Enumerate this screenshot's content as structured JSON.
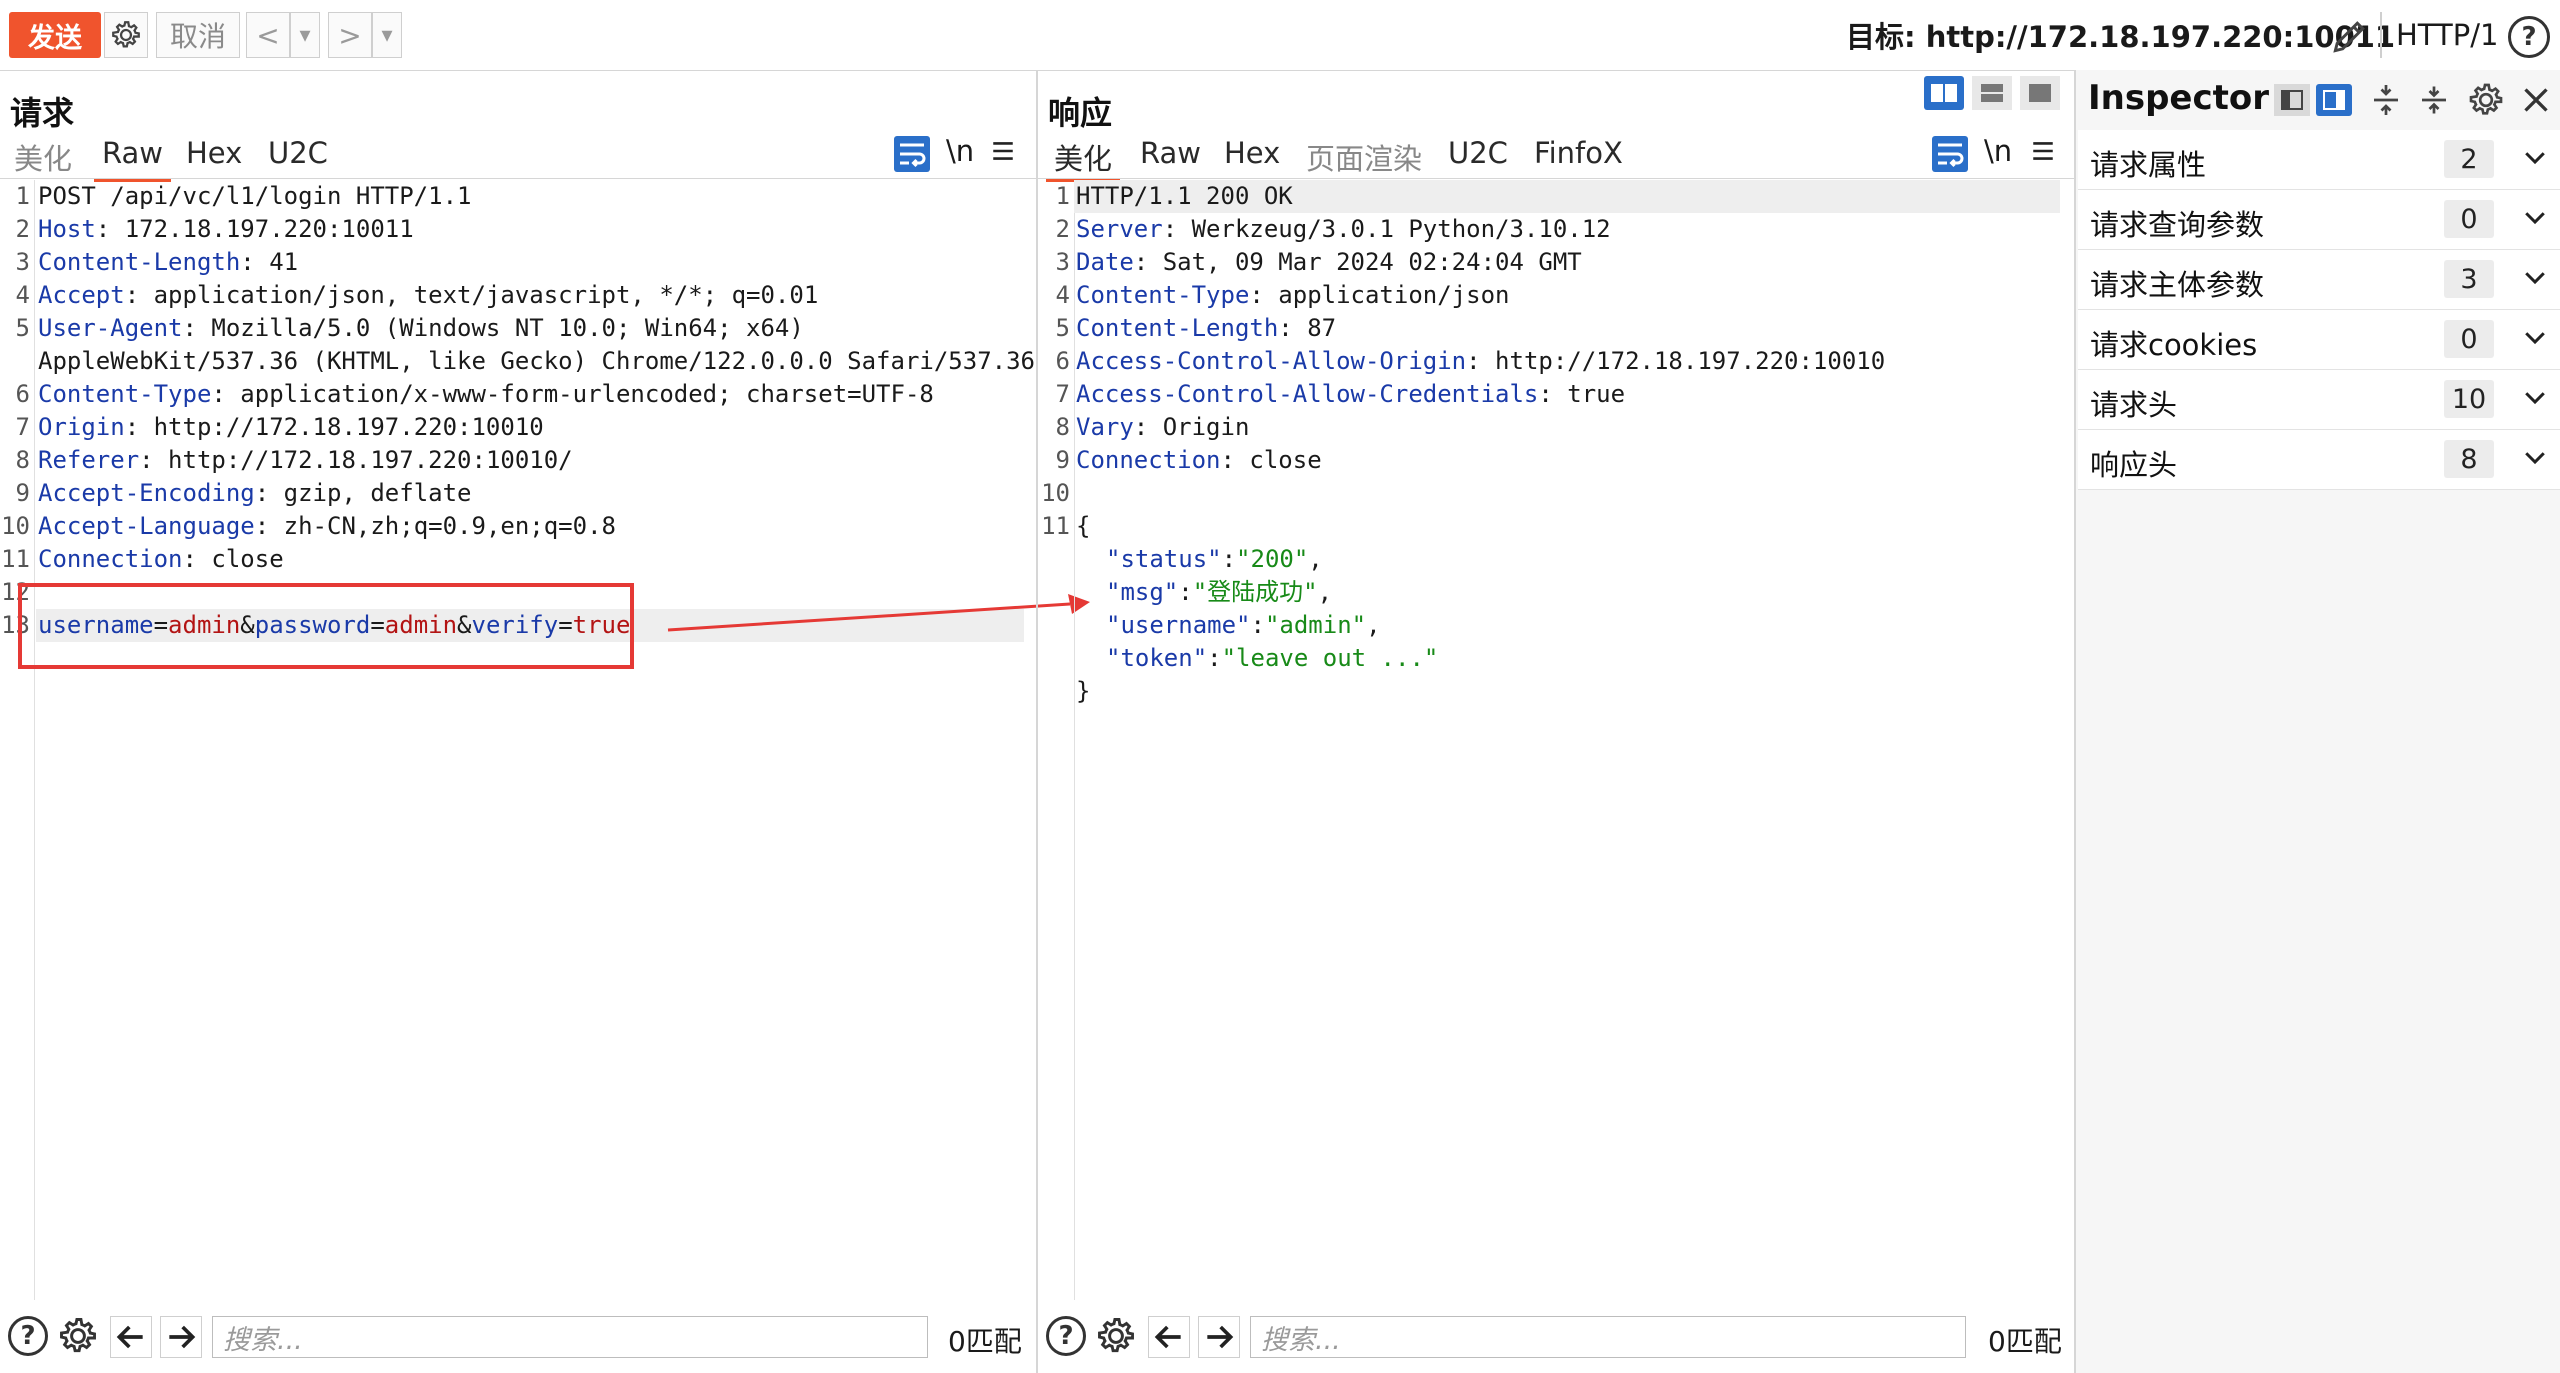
{
  "toolbar": {
    "send_label": "发送",
    "cancel_label": "取消",
    "prev_label": "<",
    "next_label": ">",
    "dropdown_glyph": "▾",
    "target_label": "目标: http://172.18.197.220:10011",
    "protocol_label": "HTTP/1",
    "help_glyph": "?"
  },
  "request": {
    "title": "请求",
    "tabs": [
      "美化",
      "Raw",
      "Hex",
      "U2C"
    ],
    "active_tab": "Raw",
    "newline_label": "\\n",
    "line_numbers": [
      "1",
      "2",
      "3",
      "4",
      "5",
      "",
      "6",
      "7",
      "8",
      "9",
      "10",
      "11",
      "12",
      "13"
    ],
    "headers": {
      "request_line": "POST /api/vc/l1/login HTTP/1.1",
      "host_key": "Host",
      "host_val": ": 172.18.197.220:10011",
      "cl_key": "Content-Length",
      "cl_val": ": 41",
      "accept_key": "Accept",
      "accept_val": ": application/json, text/javascript, */*; q=0.01",
      "ua_key": "User-Agent",
      "ua_val": ": Mozilla/5.0 (Windows NT 10.0; Win64; x64)",
      "ua_cont": "AppleWebKit/537.36 (KHTML, like Gecko) Chrome/122.0.0.0 Safari/537.36",
      "ct_key": "Content-Type",
      "ct_val": ": application/x-www-form-urlencoded; charset=UTF-8",
      "origin_key": "Origin",
      "origin_val": ": http://172.18.197.220:10010",
      "referer_key": "Referer",
      "referer_val": ": http://172.18.197.220:10010/",
      "ae_key": "Accept-Encoding",
      "ae_val": ": gzip, deflate",
      "al_key": "Accept-Language",
      "al_val": ": zh-CN,zh;q=0.9,en;q=0.8",
      "conn_key": "Connection",
      "conn_val": ": close"
    },
    "body": {
      "p1": "username",
      "eq1": "=",
      "v1": "admin",
      "amp1": "&",
      "p2": "password",
      "eq2": "=",
      "v2": "admin",
      "amp2": "&",
      "p3": "verify",
      "eq3": "=",
      "v3": "true"
    },
    "search_placeholder": "搜索...",
    "match_count": "0匹配"
  },
  "response": {
    "title": "响应",
    "tabs": [
      "美化",
      "Raw",
      "Hex",
      "页面渲染",
      "U2C",
      "FinfoX"
    ],
    "active_tab": "美化",
    "newline_label": "\\n",
    "line_numbers": [
      "1",
      "2",
      "3",
      "4",
      "5",
      "6",
      "7",
      "8",
      "9",
      "10",
      "11"
    ],
    "headers": {
      "status_line": "HTTP/1.1 200 OK",
      "server_key": "Server",
      "server_val": ": Werkzeug/3.0.1 Python/3.10.12",
      "date_key": "Date",
      "date_val": ": Sat, 09 Mar 2024 02:24:04 GMT",
      "ct_key": "Content-Type",
      "ct_val": ": application/json",
      "cl_key": "Content-Length",
      "cl_val": ": 87",
      "acao_key": "Access-Control-Allow-Origin",
      "acao_val": ": http://172.18.197.220:10010",
      "acac_key": "Access-Control-Allow-Credentials",
      "acac_val": ": true",
      "vary_key": "Vary",
      "vary_val": ": Origin",
      "conn_key": "Connection",
      "conn_val": ": close"
    },
    "json": {
      "open": "{",
      "status_key": "\"status\"",
      "status_val": "\"200\"",
      "msg_key": "\"msg\"",
      "msg_val": "\"登陆成功\"",
      "user_key": "\"username\"",
      "user_val": "\"admin\"",
      "token_key": "\"token\"",
      "token_val": "\"leave out ...\"",
      "close": "}",
      "colon": ":",
      "comma": ","
    },
    "search_placeholder": "搜索...",
    "match_count": "0匹配"
  },
  "inspector": {
    "title": "Inspector",
    "rows": [
      {
        "label": "请求属性",
        "count": "2"
      },
      {
        "label": "请求查询参数",
        "count": "0"
      },
      {
        "label": "请求主体参数",
        "count": "3"
      },
      {
        "label": "请求cookies",
        "count": "0"
      },
      {
        "label": "请求头",
        "count": "10"
      },
      {
        "label": "响应头",
        "count": "8"
      }
    ]
  },
  "colors": {
    "accent": "#f0542d",
    "header_key": "#1a3aa8",
    "param_value": "#b31414",
    "json_string": "#188a18",
    "highlight_box": "#e53935"
  }
}
